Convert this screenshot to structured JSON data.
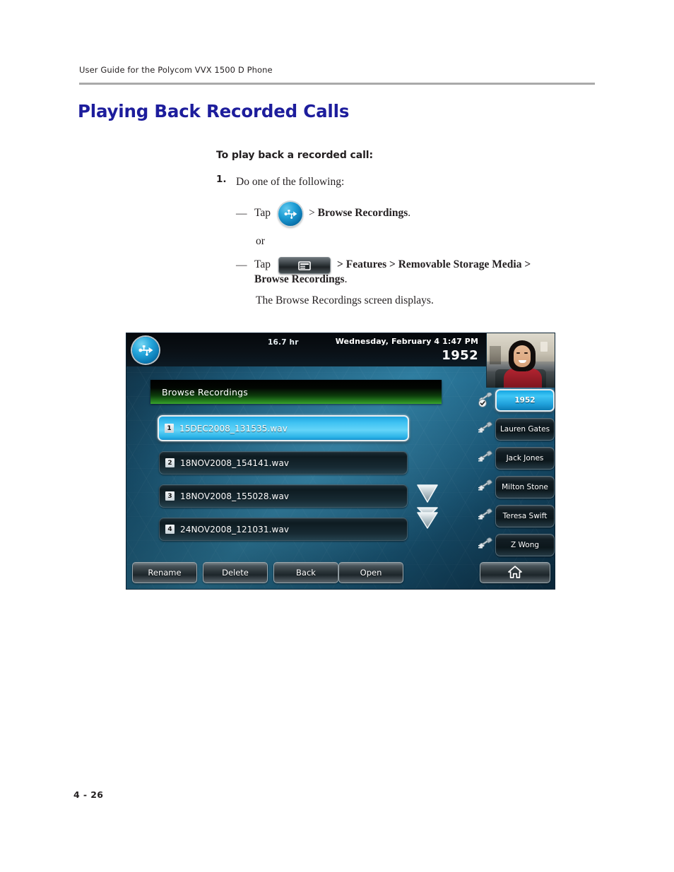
{
  "document": {
    "running_head": "User Guide for the Polycom VVX 1500 D Phone",
    "chapter_title": "Playing Back Recorded Calls",
    "folio": "4 - 26",
    "heading_color": "#1d1d9c"
  },
  "procedure": {
    "title": "To play back a recorded call:",
    "step_number": "1.",
    "step_text": "Do one of the following:",
    "bullet_one": {
      "dash": "—",
      "lead": "Tap",
      "icon": "usb-round-button-icon",
      "separator": ">",
      "target": "Browse Recordings",
      "period": "."
    },
    "or_text": "or",
    "bullet_two": {
      "dash": "—",
      "lead": "Tap",
      "icon": "menu-hard-key-icon",
      "path_line1": "> Features > Removable Storage Media >",
      "path_line2": "Browse Recordings",
      "period": "."
    },
    "result_text": "The Browse Recordings screen displays."
  },
  "phone_screen": {
    "status_bar": {
      "usb_icon": "usb-icon",
      "recording_capacity": "16.7 hr",
      "date_time": "Wednesday, February 4  1:47 PM",
      "extension": "1952"
    },
    "video_thumbnail": "near-end-video-thumbnail",
    "title_bar": {
      "label": "Browse Recordings",
      "accent_color": "#3da62f"
    },
    "file_list": [
      {
        "index": "1",
        "name": "15DEC2008_131535.wav",
        "selected": true
      },
      {
        "index": "2",
        "name": "18NOV2008_154141.wav",
        "selected": false
      },
      {
        "index": "3",
        "name": "18NOV2008_155028.wav",
        "selected": false
      },
      {
        "index": "4",
        "name": "24NOV2008_121031.wav",
        "selected": false
      }
    ],
    "scroll_controls": [
      {
        "name": "scroll-down-icon"
      },
      {
        "name": "scroll-page-down-icon"
      }
    ],
    "line_keys": [
      {
        "label": "1952",
        "icon": "handset-registered-icon",
        "active": true
      },
      {
        "label": "Lauren Gates",
        "icon": "handset-icon",
        "active": false
      },
      {
        "label": "Jack Jones",
        "icon": "handset-icon",
        "active": false
      },
      {
        "label": "Milton Stone",
        "icon": "handset-icon",
        "active": false
      },
      {
        "label": "Teresa Swift",
        "icon": "handset-icon",
        "active": false
      },
      {
        "label": "Z Wong",
        "icon": "handset-icon",
        "active": false
      }
    ],
    "soft_keys": [
      {
        "label": "Rename"
      },
      {
        "label": "Delete"
      },
      {
        "label": "Back"
      },
      {
        "label": "Open"
      }
    ],
    "home_key": {
      "icon": "home-icon",
      "label": ""
    },
    "selected_color": "#3fc2f2"
  }
}
